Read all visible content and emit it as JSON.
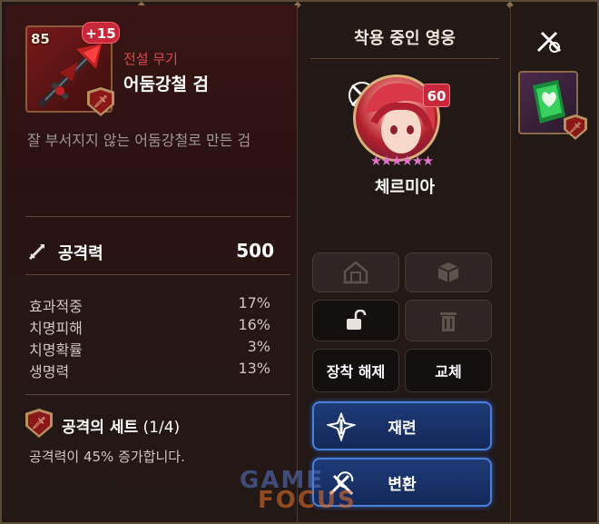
{
  "item": {
    "level": "85",
    "enhance": "+15",
    "rarity": "전설 무기",
    "name": "어둠강철 검",
    "description": "잘 부서지지 않는 어둠강철로 만든 검",
    "main_stat": {
      "label": "공격력",
      "value": "500"
    },
    "sub_stats": [
      {
        "label": "효과적중",
        "value": "17%"
      },
      {
        "label": "치명피해",
        "value": "16%"
      },
      {
        "label": "치명확률",
        "value": "3%"
      },
      {
        "label": "생명력",
        "value": "13%"
      }
    ],
    "set": {
      "name": "공격의 세트",
      "count": "(1/4)",
      "description": "공격력이 45% 증가합니다."
    }
  },
  "hero": {
    "section_title": "착용 중인 영웅",
    "level": "60",
    "stars": "★★★★★★",
    "name": "체르미아"
  },
  "buttons": {
    "unequip": "장착 해제",
    "swap": "교체",
    "reforge": "재련",
    "convert": "변환"
  },
  "watermark": {
    "line1": "GAME",
    "line2": "FOCUS"
  },
  "colors": {
    "rarity": "#e04848",
    "badge_red": "#c8283a",
    "button_blue": "#4a80d8"
  }
}
